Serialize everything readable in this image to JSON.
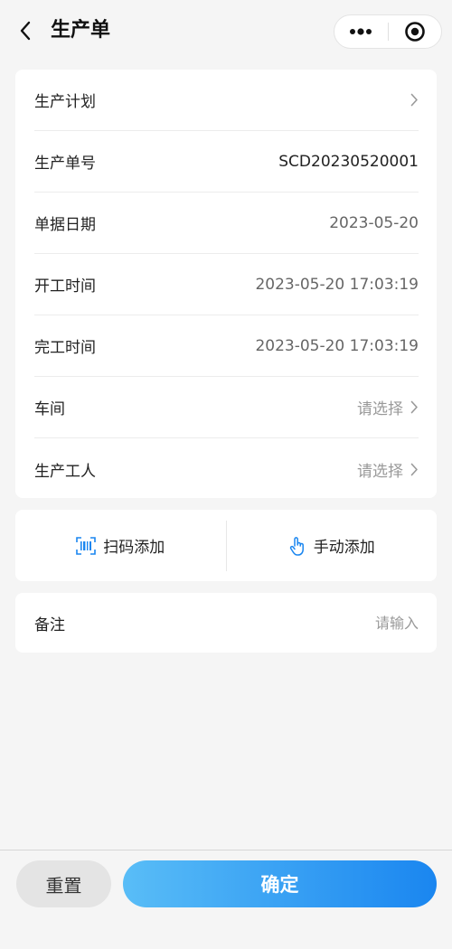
{
  "navbar": {
    "title": "生产单",
    "back_icon": "chevron-left-icon",
    "more_icon": "more-dots-icon",
    "close_icon": "target-circle-icon"
  },
  "form": {
    "rows": [
      {
        "label": "生产计划",
        "value": "",
        "type": "link"
      },
      {
        "label": "生产单号",
        "value": "SCD20230520001",
        "type": "text"
      },
      {
        "label": "单据日期",
        "value": "2023-05-20",
        "type": "text"
      },
      {
        "label": "开工时间",
        "value": "2023-05-20 17:03:19",
        "type": "text"
      },
      {
        "label": "完工时间",
        "value": "2023-05-20 17:03:19",
        "type": "text"
      },
      {
        "label": "车间",
        "value": "请选择",
        "type": "select"
      },
      {
        "label": "生产工人",
        "value": "请选择",
        "type": "select"
      }
    ]
  },
  "actions": {
    "scan_label": "扫码添加",
    "manual_label": "手动添加",
    "accent_color": "#1a86f0"
  },
  "remark": {
    "label": "备注",
    "placeholder": "请输入",
    "value": ""
  },
  "footer": {
    "reset_label": "重置",
    "confirm_label": "确定"
  }
}
